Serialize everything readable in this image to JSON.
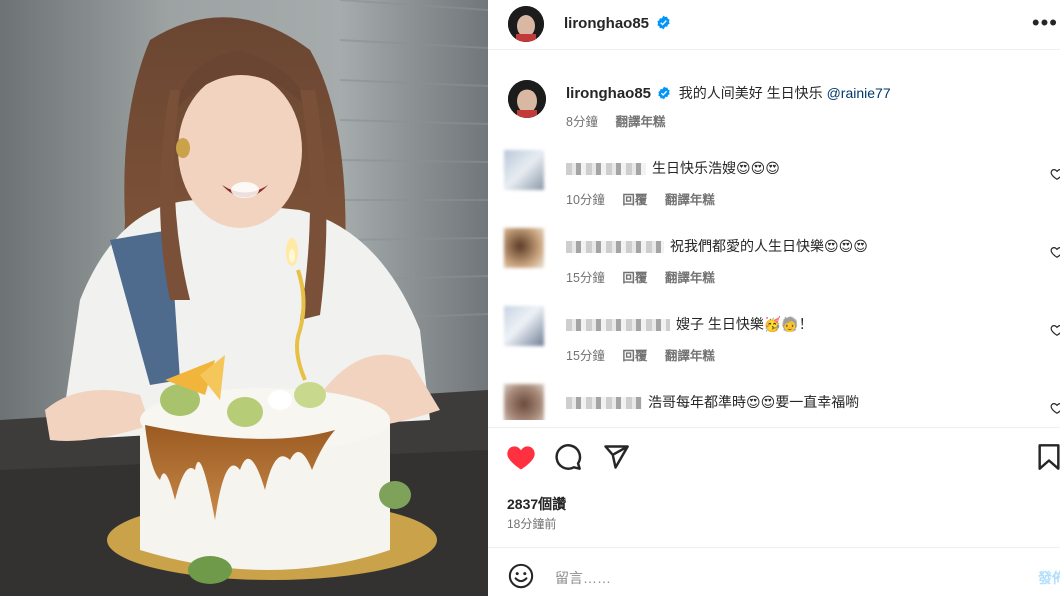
{
  "post": {
    "username": "lironghao85",
    "verified": true
  },
  "caption": {
    "username": "lironghao85",
    "text": "我的人间美好 生日快乐 ",
    "mention": "@rainie77",
    "time": "8分鐘",
    "translate": "翻譯年糕"
  },
  "comments": [
    {
      "text": "生日快乐浩嫂😍😍😍",
      "time": "10分鐘",
      "reply": "回覆",
      "translate": "翻譯年糕"
    },
    {
      "text": "祝我們都愛的人生日快樂😍😍😍",
      "time": "15分鐘",
      "reply": "回覆",
      "translate": "翻譯年糕"
    },
    {
      "text": "嫂子 生日快樂🥳🧓！",
      "time": "15分鐘",
      "reply": "回覆",
      "translate": "翻譯年糕"
    },
    {
      "text": "浩哥每年都準時😍😍要一直幸福喲",
      "time": "",
      "reply": "",
      "translate": ""
    }
  ],
  "stats": {
    "likes": "2837個讚",
    "posted": "18分鐘前"
  },
  "composer": {
    "placeholder": "留言……",
    "post_label": "發佈"
  },
  "icons": {
    "like": "heart-filled-icon",
    "comment": "comment-icon",
    "share": "send-icon",
    "save": "bookmark-icon",
    "emoji": "emoji-icon",
    "more": "more-icon",
    "verified": "verified-badge-icon"
  },
  "colors": {
    "like_red": "#ff3040",
    "verified_blue": "#0095f6",
    "mention": "#00376b",
    "post_button": "#b2dffc"
  }
}
